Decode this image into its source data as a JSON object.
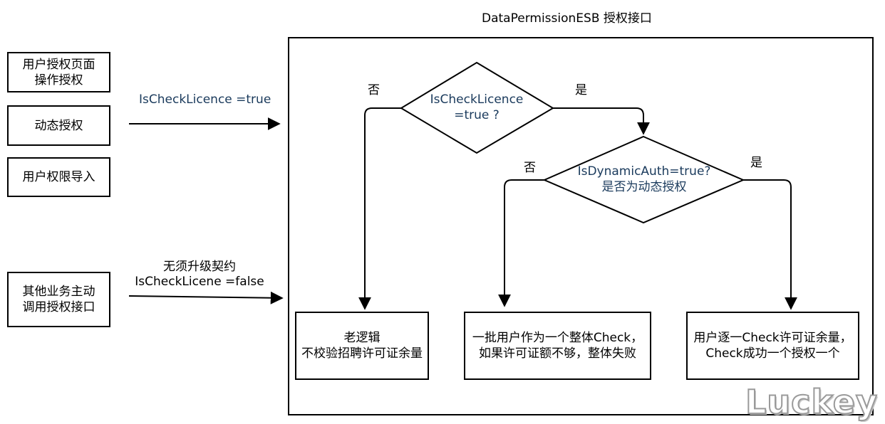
{
  "diagram": {
    "title": "DataPermissionESB 授权接口",
    "sources": {
      "user_page": "用户授权页面\n操作授权",
      "dynamic": "动态授权",
      "import": "用户权限导入",
      "other": "其他业务主动\n调用授权接口"
    },
    "edge_labels": {
      "top_call": "IsCheckLicence  =true",
      "bottom_call": "无须升级契约\nIsCheckLicene =false",
      "d1_no": "否",
      "d1_yes": "是",
      "d2_no": "否",
      "d2_yes": "是"
    },
    "decisions": {
      "d1": "IsCheckLicence\n=true ?",
      "d2": "IsDynamicAuth=true?\n是否为动态授权"
    },
    "results": {
      "old_logic": "老逻辑\n不校验招聘许可证余量",
      "batch_check": "一批用户作为一个整体Check，\n如果许可证额不够，整体失败",
      "per_user_check": "用户逐一Check许可证余量，\nCheck成功一个授权一个"
    },
    "watermark": "Luckey"
  }
}
